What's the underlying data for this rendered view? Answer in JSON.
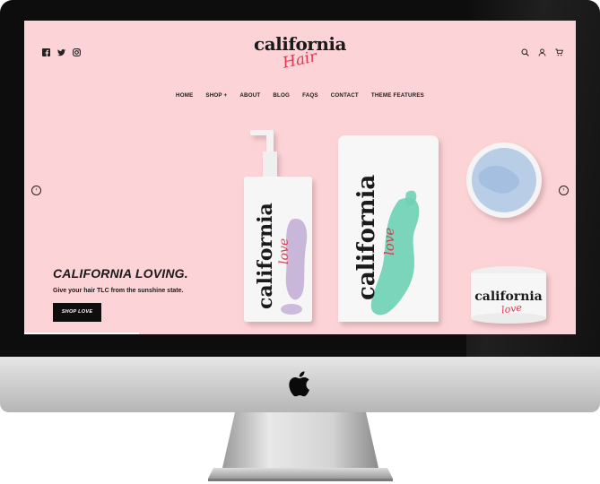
{
  "site": {
    "logo_main": "california",
    "logo_script": "Hair"
  },
  "social": [
    {
      "name": "facebook-icon",
      "glyph": "f"
    },
    {
      "name": "twitter-icon",
      "glyph": "🐦"
    },
    {
      "name": "instagram-icon",
      "glyph": "◎"
    }
  ],
  "nav": {
    "items": [
      "HOME",
      "SHOP +",
      "ABOUT",
      "BLOG",
      "FAQS",
      "CONTACT",
      "THEME FEATURES"
    ]
  },
  "hero": {
    "title": "CALIFORNIA LOVING.",
    "subtitle": "Give your hair TLC from the sunshine state.",
    "cta_label": "SHOP LOVE"
  },
  "products": {
    "brand": "california",
    "script": "love"
  },
  "colors": {
    "background": "#fcd3d6",
    "accent": "#e0364f",
    "cta": "#0e0e0e"
  }
}
